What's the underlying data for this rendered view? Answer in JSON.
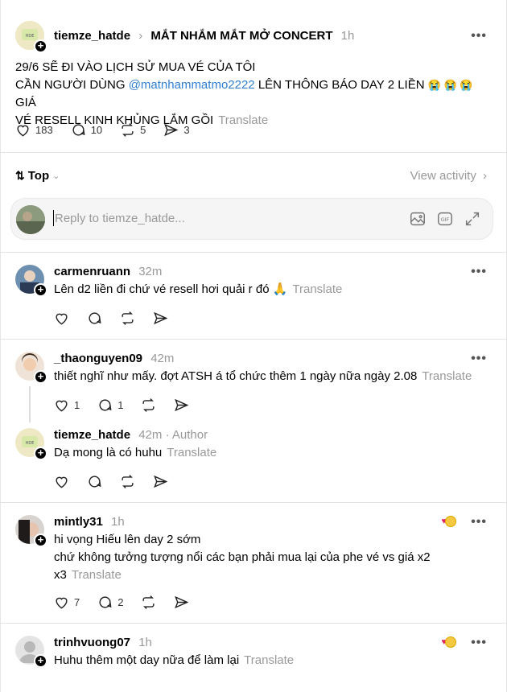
{
  "post": {
    "username": "tiemze_hatde",
    "breadcrumb_sep": "›",
    "community": "MẮT NHẮM MẮT MỞ CONCERT",
    "time": "1h",
    "line1": "29/6 SẼ ĐI VÀO LỊCH SỬ MUA VÉ CỦA TÔI",
    "line2_a": "CẦN NGƯỜI DÙNG ",
    "mention": "@matnhammatmo2222",
    "line2_b": " LÊN THÔNG BÁO DAY 2 LIỀN",
    "emojis": "😭 😭 😭",
    "line2_c": "  GIÁ",
    "line3": "VÉ RESELL KINH KHỦNG LẮM GỒI",
    "translate": "Translate",
    "likes": "183",
    "comments": "10",
    "reposts": "5",
    "shares": "3"
  },
  "sort": {
    "label": "Top",
    "view_activity": "View activity"
  },
  "reply": {
    "placeholder": "Reply to tiemze_hatde..."
  },
  "comments": [
    {
      "username": "carmenruann",
      "time": "32m",
      "text": "Lên d2 liền đi chứ vé resell hơi quải r đó 🙏",
      "translate": "Translate"
    },
    {
      "username": "_thaonguyen09",
      "time": "42m",
      "text": "thiết nghĩ như mấy. đợt ATSH á tổ chức thêm 1 ngày nữa ngày 2.08",
      "translate": "Translate",
      "likes": "1",
      "comments": "1"
    },
    {
      "username": "tiemze_hatde",
      "time": "42m",
      "author": "· Author",
      "text": "Dạ mong là có huhu",
      "translate": "Translate"
    },
    {
      "username": "mintly31",
      "time": "1h",
      "text1": "hi vọng Hiếu lên day 2 sớm",
      "text2": "chứ không tưởng tượng nổi các bạn phải mua lại của phe vé vs giá x2",
      "text3": "x3",
      "translate": "Translate",
      "likes": "7",
      "comments": "2"
    },
    {
      "username": "trinhvuong07",
      "time": "1h",
      "text": "Huhu thêm một day nữa để làm lại",
      "translate": "Translate"
    }
  ],
  "more": "•••",
  "plus": "+"
}
